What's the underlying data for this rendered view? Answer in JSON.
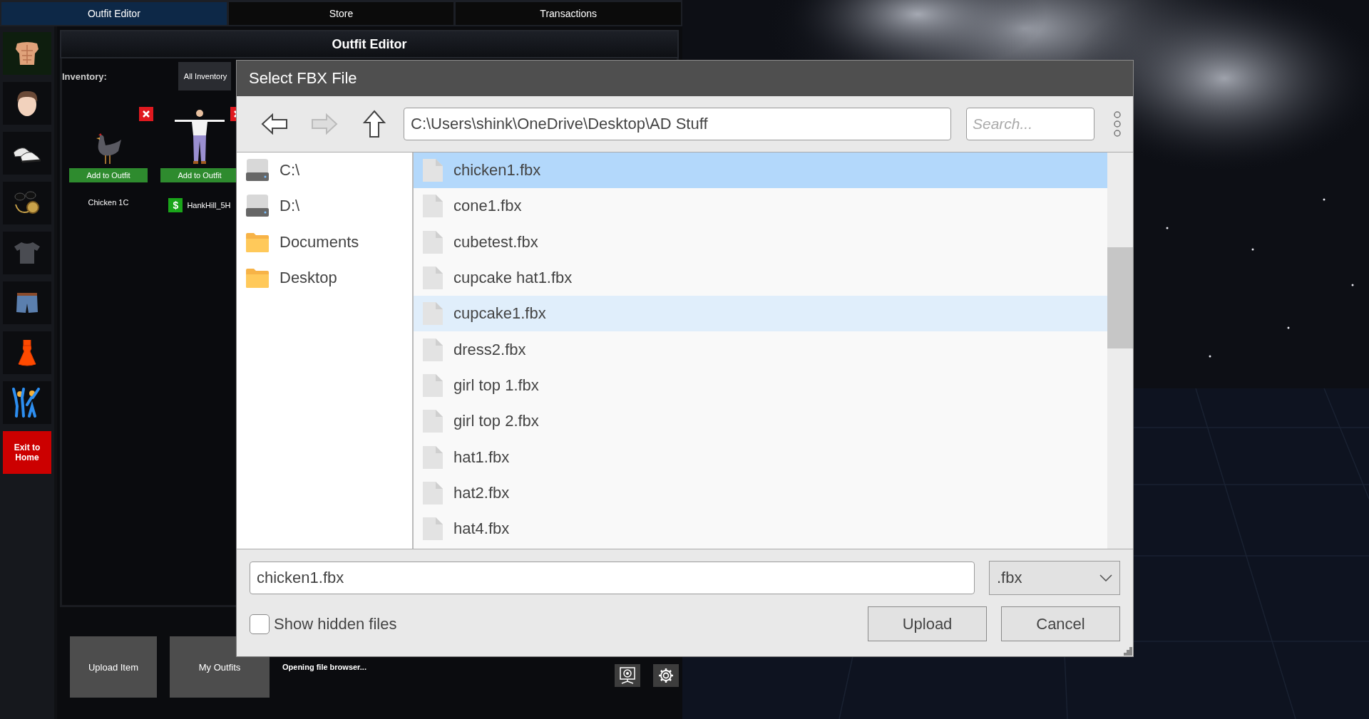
{
  "tabs": [
    {
      "label": "Outfit Editor",
      "selected": true
    },
    {
      "label": "Store",
      "selected": false
    },
    {
      "label": "Transactions",
      "selected": false
    }
  ],
  "sidebar": {
    "items": [
      {
        "kind": "torso",
        "selected": true
      },
      {
        "kind": "head",
        "selected": false
      },
      {
        "kind": "shoes",
        "selected": false
      },
      {
        "kind": "accessories",
        "selected": false
      },
      {
        "kind": "shirt",
        "selected": false
      },
      {
        "kind": "shorts",
        "selected": false
      },
      {
        "kind": "dress",
        "selected": false
      },
      {
        "kind": "dance",
        "selected": false
      }
    ],
    "exit_button": "Exit to Home"
  },
  "panel": {
    "title": "Outfit Editor",
    "inventory_label": "Inventory:",
    "filter": "All Inventory",
    "items": [
      {
        "name": "Chicken 1C",
        "kind": "chicken",
        "button": "Add to Outfit"
      },
      {
        "name": "HankHill_5H",
        "kind": "figure",
        "button": "Add to Outfit",
        "badge": "$"
      }
    ]
  },
  "bottom": {
    "buttons": [
      "Upload Item",
      "My Outfits"
    ],
    "status": "Opening file browser..."
  },
  "dialog": {
    "title": "Select FBX File",
    "nav": [
      {
        "kind": "back",
        "disabled": false
      },
      {
        "kind": "forward",
        "disabled": true
      },
      {
        "kind": "up",
        "disabled": false
      }
    ],
    "path": "C:\\Users\\shink\\OneDrive\\Desktop\\AD Stuff",
    "search_placeholder": "Search...",
    "places": [
      {
        "label": "C:\\",
        "kind": "drive"
      },
      {
        "label": "D:\\",
        "kind": "drive"
      },
      {
        "label": "Documents",
        "kind": "folder"
      },
      {
        "label": "Desktop",
        "kind": "folder"
      }
    ],
    "files": [
      {
        "name": "chicken1.fbx",
        "selected": true,
        "hovered": false
      },
      {
        "name": "cone1.fbx",
        "selected": false,
        "hovered": false
      },
      {
        "name": "cubetest.fbx",
        "selected": false,
        "hovered": false
      },
      {
        "name": "cupcake hat1.fbx",
        "selected": false,
        "hovered": false
      },
      {
        "name": "cupcake1.fbx",
        "selected": false,
        "hovered": true
      },
      {
        "name": "dress2.fbx",
        "selected": false,
        "hovered": false
      },
      {
        "name": "girl top 1.fbx",
        "selected": false,
        "hovered": false
      },
      {
        "name": "girl top 2.fbx",
        "selected": false,
        "hovered": false
      },
      {
        "name": "hat1.fbx",
        "selected": false,
        "hovered": false
      },
      {
        "name": "hat2.fbx",
        "selected": false,
        "hovered": false
      },
      {
        "name": "hat4.fbx",
        "selected": false,
        "hovered": false
      }
    ],
    "filename": "chicken1.fbx",
    "filter": ".fbx",
    "show_hidden": {
      "label": "Show hidden files",
      "checked": false
    },
    "buttons": [
      "Upload",
      "Cancel"
    ]
  }
}
